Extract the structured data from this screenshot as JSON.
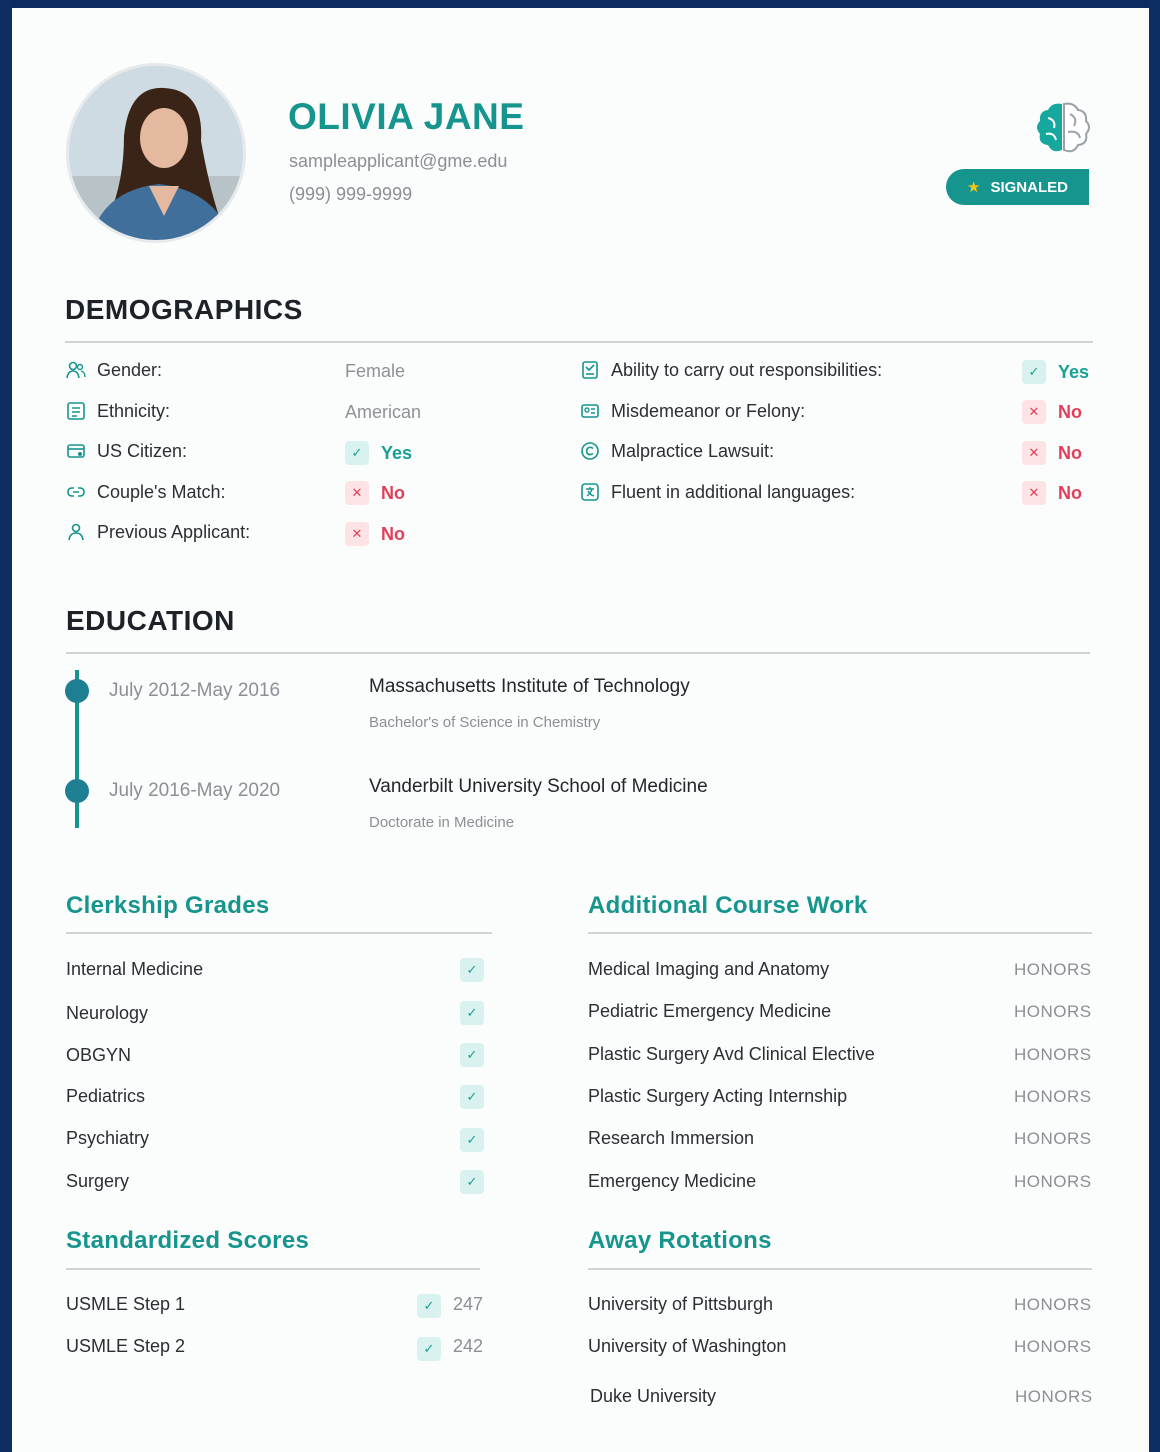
{
  "profile": {
    "name": "OLIVIA JANE",
    "email": "sampleapplicant@gme.edu",
    "phone": "(999) 999-9999",
    "badge": "SIGNALED"
  },
  "demographics": {
    "title": "DEMOGRAPHICS",
    "left": [
      {
        "label": "Gender:",
        "value": "Female",
        "icon": "people-icon"
      },
      {
        "label": "Ethnicity:",
        "value": "American",
        "icon": "id-card-icon"
      },
      {
        "label": "US Citizen:",
        "value": "Yes",
        "icon": "passport-icon"
      },
      {
        "label": "Couple's Match:",
        "value": "No",
        "icon": "link-icon"
      },
      {
        "label": "Previous Applicant:",
        "value": "No",
        "icon": "person-icon"
      }
    ],
    "right": [
      {
        "label": "Ability to carry out responsibilities:",
        "value": "Yes",
        "icon": "document-icon"
      },
      {
        "label": "Misdemeanor or Felony:",
        "value": "No",
        "icon": "id-card-icon"
      },
      {
        "label": "Malpractice Lawsuit:",
        "value": "No",
        "icon": "copyright-icon"
      },
      {
        "label": "Fluent in additional languages:",
        "value": "No",
        "icon": "translate-icon"
      }
    ]
  },
  "education": {
    "title": "EDUCATION",
    "entries": [
      {
        "dates": "July 2012-May 2016",
        "school": "Massachusetts Institute of Technology",
        "degree": "Bachelor's of Science in Chemistry"
      },
      {
        "dates": "July 2016-May 2020",
        "school": "Vanderbilt University School of Medicine",
        "degree": "Doctorate in Medicine"
      }
    ]
  },
  "clerkship": {
    "title": "Clerkship Grades",
    "items": [
      "Internal Medicine",
      "Neurology",
      "OBGYN",
      "Pediatrics",
      "Psychiatry",
      "Surgery"
    ]
  },
  "coursework": {
    "title": "Additional Course Work",
    "items": [
      {
        "name": "Medical Imaging and Anatomy",
        "grade": "HONORS"
      },
      {
        "name": "Pediatric Emergency Medicine",
        "grade": "HONORS"
      },
      {
        "name": "Plastic Surgery Avd Clinical Elective",
        "grade": "HONORS"
      },
      {
        "name": "Plastic Surgery Acting Internship",
        "grade": "HONORS"
      },
      {
        "name": "Research Immersion",
        "grade": "HONORS"
      },
      {
        "name": "Emergency Medicine",
        "grade": "HONORS"
      }
    ]
  },
  "scores": {
    "title": "Standardized Scores",
    "items": [
      {
        "name": "USMLE Step 1",
        "score": "247"
      },
      {
        "name": "USMLE Step 2",
        "score": "242"
      }
    ]
  },
  "rotations": {
    "title": "Away Rotations",
    "items": [
      {
        "name": "University of Pittsburgh",
        "grade": "HONORS"
      },
      {
        "name": "University of Washington",
        "grade": "HONORS"
      },
      {
        "name": "Duke University",
        "grade": "HONORS"
      }
    ]
  },
  "colors": {
    "accent": "#16958e",
    "yes": "#18a096",
    "no": "#e23e57",
    "background": "#0d2b5e"
  }
}
